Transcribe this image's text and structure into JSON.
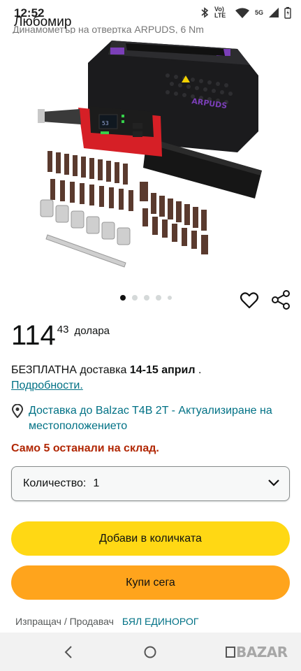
{
  "status_bar": {
    "time": "12:52",
    "owner": "Любомир",
    "network_label": "Vo) LTE",
    "signal_label": "5G"
  },
  "title_strip": "Динамометър на отвертка ARPUDS, 6 Nm",
  "product": {
    "brand_on_case": "ARPUDS",
    "screen_readout": "53",
    "gallery_total": 5,
    "gallery_active_index": 0
  },
  "price": {
    "whole": "114",
    "fraction": "43",
    "currency": "долара"
  },
  "delivery": {
    "prefix": "БЕЗПЛАТНА доставка ",
    "dates": "14-15 април",
    "suffix": " .",
    "details_link": "Подробности."
  },
  "location": {
    "text": "Доставка до Balzac T4B 2T - Актуализиране на местоположението"
  },
  "stock_message": "Само 5 останали на склад.",
  "quantity": {
    "label": "Количество:",
    "value": "1"
  },
  "buttons": {
    "add_to_cart": "Добави в количката",
    "buy_now": "Купи сега"
  },
  "seller": {
    "label": "Изпращач / Продавач",
    "name": "БЯЛ ЕДИНОРОГ"
  },
  "watermark": "BAZAR",
  "colors": {
    "link": "#007185",
    "stock_red": "#b12704",
    "cart_yellow": "#ffd814",
    "buy_orange": "#ffa41c",
    "tool_red": "#d61f26",
    "case_purple": "#7b3fb8"
  },
  "icons": {
    "heart": "heart-icon",
    "share": "share-icon",
    "location": "location-pin-icon",
    "chevron": "chevron-down-icon"
  }
}
